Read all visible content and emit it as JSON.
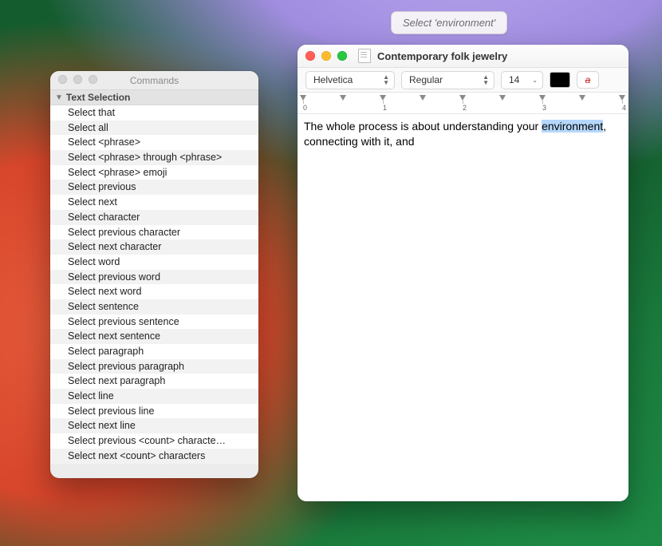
{
  "siri": {
    "suggestion": "Select 'environment'"
  },
  "commands_window": {
    "title": "Commands",
    "group_label": "Text Selection",
    "items": [
      "Select that",
      "Select all",
      "Select <phrase>",
      "Select <phrase> through <phrase>",
      "Select <phrase> emoji",
      "Select previous",
      "Select next",
      "Select character",
      "Select previous character",
      "Select next character",
      "Select word",
      "Select previous word",
      "Select next word",
      "Select sentence",
      "Select previous sentence",
      "Select next sentence",
      "Select paragraph",
      "Select previous paragraph",
      "Select next paragraph",
      "Select line",
      "Select previous line",
      "Select next line",
      "Select previous <count> characte…",
      "Select next <count> characters"
    ]
  },
  "document_window": {
    "title": "Contemporary folk jewelry",
    "toolbar": {
      "font": "Helvetica",
      "style": "Regular",
      "size": "14",
      "text_color": "#000000",
      "strike_glyph": "a"
    },
    "ruler": {
      "labels": [
        "0",
        "1",
        "2",
        "3",
        "4"
      ]
    },
    "body": {
      "before": "The whole process is about understanding your ",
      "highlight": "environment",
      "after": ", connecting with it, and"
    }
  }
}
